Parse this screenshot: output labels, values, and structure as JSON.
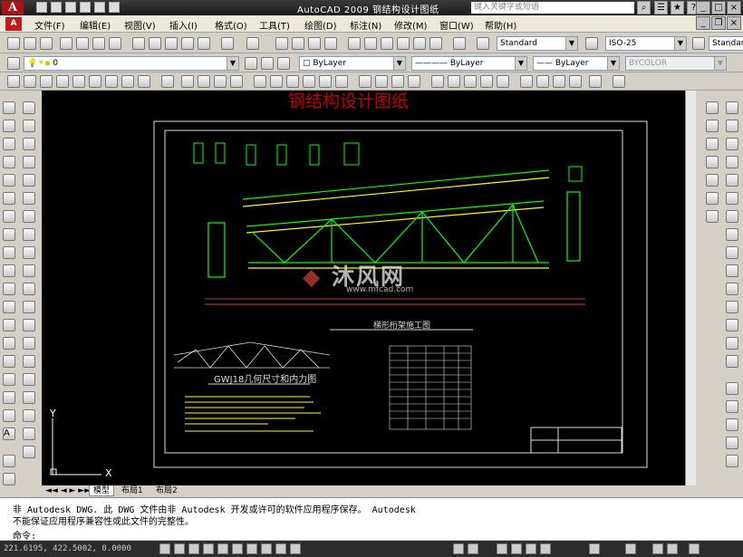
{
  "titlebar": {
    "app_letter": "A",
    "title": "AutoCAD 2009  钢结构设计图纸",
    "search_placeholder": "键入关键字或短语"
  },
  "menubar": {
    "items": [
      "文件(F)",
      "编辑(E)",
      "视图(V)",
      "插入(I)",
      "格式(O)",
      "工具(T)",
      "绘图(D)",
      "标注(N)",
      "修改(M)",
      "窗口(W)",
      "帮助(H)"
    ]
  },
  "toolbar2": {
    "text_style": "Standard",
    "dim_style": "ISO-25",
    "table_style": "Standar"
  },
  "toolbar3": {
    "layer": "0",
    "color": "ByLayer",
    "linetype": "ByLayer",
    "lineweight": "ByLayer",
    "plotstyle": "BYCOLOR"
  },
  "drawing": {
    "overlay_title": "钢结构设计图纸",
    "main_title": "梯形桁架施工图",
    "sub_title": "GWJ18几何尺寸和内力图",
    "watermark_cn": "沐风网",
    "watermark_url": "www.mfcad.com",
    "axis_y": "Y",
    "axis_x": "X"
  },
  "tabs": [
    "模型",
    "布局1",
    "布局2"
  ],
  "command": {
    "line1": "非 Autodesk DWG.   此 DWG 文件由非 Autodesk 开发或许可的软件应用程序保存。   Autodesk",
    "line2": "不能保证应用程序兼容性或此文件的完整性。",
    "prompt": "命令:"
  },
  "status": {
    "coords": "221.6195, 422.5002, 0.0000"
  },
  "colors": {
    "drawing_green": "#00ff00",
    "drawing_yellow": "#ffff00",
    "overlay_red": "#c00000",
    "canvas_bg": "#000000"
  }
}
